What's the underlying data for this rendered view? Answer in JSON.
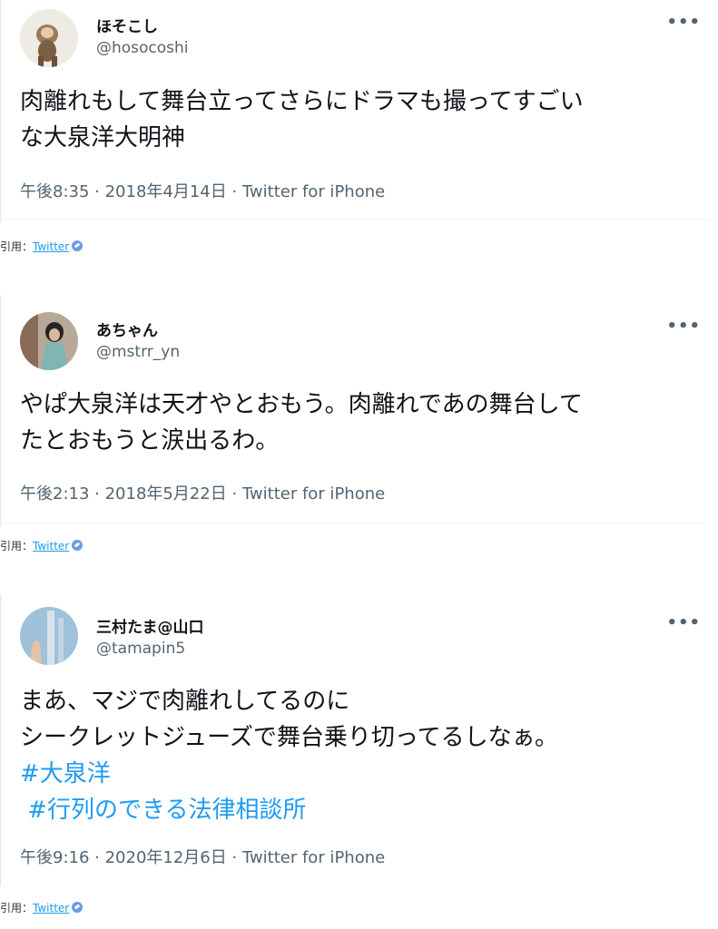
{
  "tweets": [
    {
      "name": "ほそこし",
      "handle": "@hosocoshi",
      "lines": [
        "肉離れもして舞台立ってさらにドラマも撮ってすごい",
        "な大泉洋大明神"
      ],
      "meta": "午後8:35 · 2018年4月14日 · Twitter for iPhone",
      "more_icon": "more-icon"
    },
    {
      "name": "あちゃん",
      "handle": "@mstrr_yn",
      "lines": [
        "やぱ大泉洋は天才やとおもう。肉離れであの舞台して",
        "たとおもうと涙出るわ。"
      ],
      "meta": "午後2:13 · 2018年5月22日 · Twitter for iPhone",
      "more_icon": "more-icon"
    },
    {
      "name": "三村たま@山口",
      "handle": "@tamapin5",
      "lines": [
        "まあ、マジで肉離れしてるのに",
        "シークレットジューズで舞台乗り切ってるしなぁ。"
      ],
      "hashtags": [
        "#大泉洋",
        " #行列のできる法律相談所"
      ],
      "meta": "午後9:16 · 2020年12月6日 · Twitter for iPhone",
      "more_icon": "more-icon"
    }
  ],
  "quotes": [
    {
      "prefix": "引用：",
      "link": "Twitter"
    },
    {
      "prefix": "引用：",
      "link": "Twitter"
    },
    {
      "prefix": "引用：",
      "link": "Twitter"
    }
  ],
  "colors": {
    "hashtag": "#1d9bf0",
    "secondary_text": "#536471",
    "quote_icon": "#6b9be6"
  }
}
